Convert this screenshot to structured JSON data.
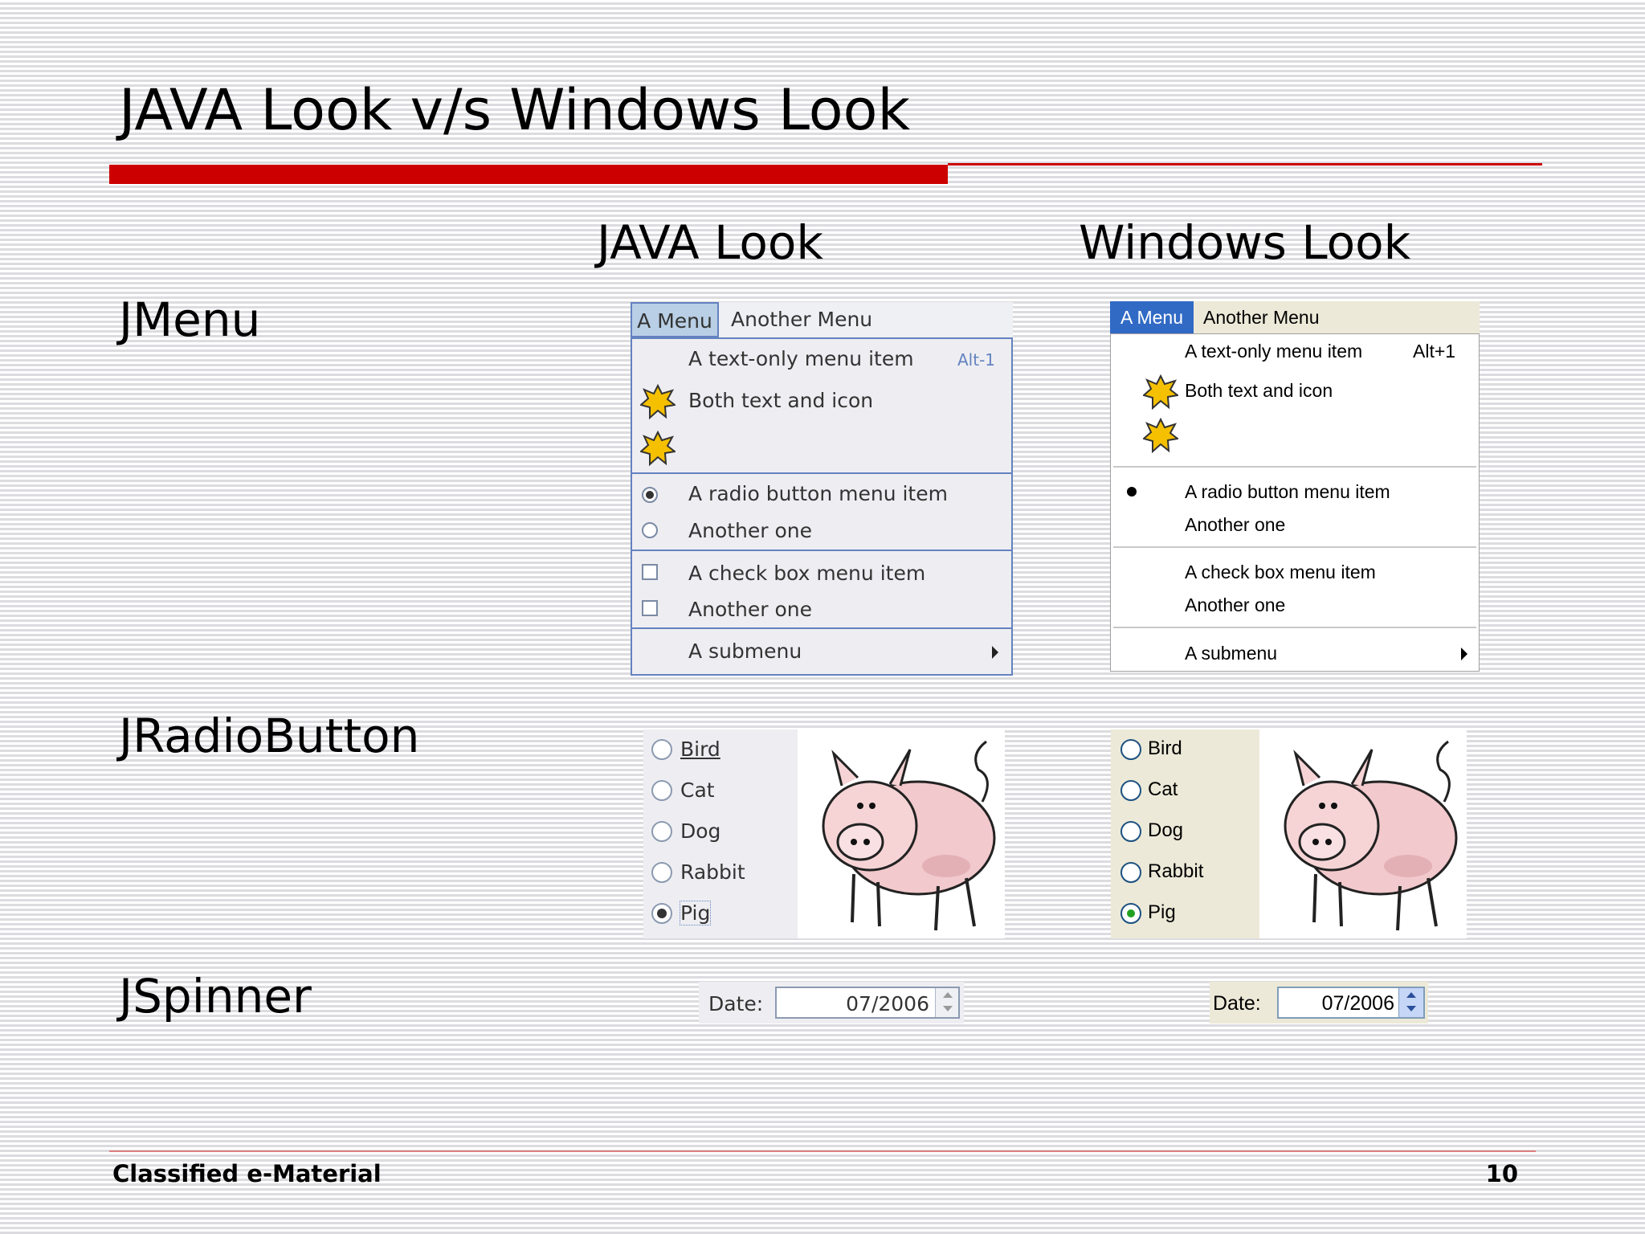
{
  "slide": {
    "title": "JAVA Look v/s Windows Look",
    "footer_left": "Classified e-Material",
    "page_number": "10"
  },
  "columns": {
    "java": "JAVA Look",
    "windows": "Windows Look"
  },
  "rows": {
    "jmenu": "JMenu",
    "jradiobutton": "JRadioButton",
    "jspinner": "JSpinner"
  },
  "java_menu": {
    "menubar": [
      "A Menu",
      "Another Menu"
    ],
    "items": {
      "text_only": "A text-only menu item",
      "accelerator": "Alt-1",
      "text_icon": "Both text and icon",
      "radio1": "A radio button menu item",
      "radio2": "Another one",
      "check1": "A check box menu item",
      "check2": "Another one",
      "submenu": "A submenu"
    }
  },
  "windows_menu": {
    "menubar": [
      "A Menu",
      "Another Menu"
    ],
    "items": {
      "text_only": "A text-only menu item",
      "accelerator": "Alt+1",
      "text_icon": "Both text and icon",
      "radio1": "A radio button menu item",
      "radio2": "Another one",
      "check1": "A check box menu item",
      "check2": "Another one",
      "submenu": "A submenu"
    }
  },
  "radio_options": [
    "Bird",
    "Cat",
    "Dog",
    "Rabbit",
    "Pig"
  ],
  "radio_selected": "Pig",
  "spinner": {
    "label": "Date:",
    "value": "07/2006"
  },
  "colors": {
    "accent_red": "#cc0000",
    "java_menu_border": "#6382bf",
    "windows_selection": "#316ac5"
  },
  "icons": [
    "star-burst-icon",
    "pig-image",
    "submenu-arrow-icon"
  ]
}
